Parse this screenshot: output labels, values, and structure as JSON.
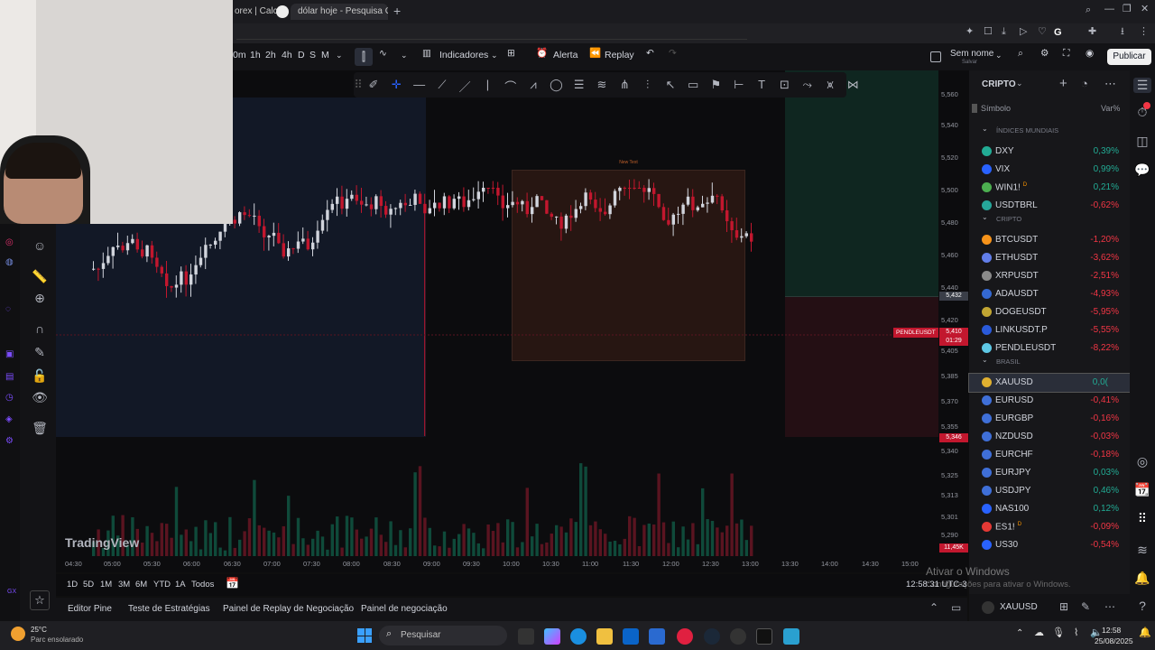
{
  "browser": {
    "tabs": [
      {
        "label": "orex | Calc"
      },
      {
        "label": "dólar hoje - Pesquisa Goo"
      }
    ],
    "new_tab": "+"
  },
  "toolbar": {
    "intervals": [
      "0m",
      "1h",
      "2h",
      "4h",
      "D",
      "S",
      "M"
    ],
    "indicators": "Indicadores",
    "alert": "Alerta",
    "replay": "Replay",
    "layout_name": "Sem nome",
    "layout_sub": "Salvar",
    "publish": "Publicar"
  },
  "chart": {
    "watermark": "TradingView",
    "box_label": "New Text",
    "symbol_tag": "PENDLEUSDT",
    "prices": [
      "5,560",
      "5,540",
      "5,520",
      "5,500",
      "5,480",
      "5,460",
      "5,440",
      "5,420",
      "5,405",
      "5,385",
      "5,370",
      "5,355",
      "5,340",
      "5,325",
      "5,313",
      "5,301",
      "5,290"
    ],
    "price_tags": {
      "current": "5,432",
      "last": "5,410",
      "countdown": "01:29",
      "low": "5,346",
      "volume": "11,45K"
    },
    "times": [
      "04:30",
      "05:00",
      "05:30",
      "06:00",
      "06:30",
      "07:00",
      "07:30",
      "08:00",
      "08:30",
      "09:00",
      "09:30",
      "10:00",
      "10:30",
      "11:00",
      "11:30",
      "12:00",
      "12:30",
      "13:00",
      "13:30",
      "14:00",
      "14:30",
      "15:00"
    ]
  },
  "range_bar": {
    "ranges": [
      "1D",
      "5D",
      "1M",
      "3M",
      "6M",
      "YTD",
      "1A",
      "Todos"
    ],
    "clock": "12:58:31 UTC-3"
  },
  "bottom_tabs": [
    "Editor Pine",
    "Teste de Estratégias",
    "Painel de Replay de Negociação",
    "Painel de negociação"
  ],
  "watchlist": {
    "title": "CRIPTO",
    "col_symbol": "Símbolo",
    "col_change": "Var%",
    "sections": [
      {
        "name": "ÍNDICES MUNDIAIS",
        "items": [
          {
            "symbol": "DXY",
            "change": "0,39%",
            "dir": "pos",
            "color": "#22ab94"
          },
          {
            "symbol": "VIX",
            "change": "0,99%",
            "dir": "pos",
            "color": "#2962ff"
          },
          {
            "symbol": "WIN1!",
            "mark": "D",
            "change": "0,21%",
            "dir": "pos",
            "color": "#4caf50"
          },
          {
            "symbol": "USDTBRL",
            "change": "-0,62%",
            "dir": "neg",
            "color": "#26a69a"
          }
        ]
      },
      {
        "name": "CRIPTO",
        "items": [
          {
            "symbol": "BTCUSDT",
            "change": "-1,20%",
            "dir": "neg",
            "color": "#f7931a"
          },
          {
            "symbol": "ETHUSDT",
            "change": "-3,62%",
            "dir": "neg",
            "color": "#627eea"
          },
          {
            "symbol": "XRPUSDT",
            "change": "-2,51%",
            "dir": "neg",
            "color": "#8a8a8a"
          },
          {
            "symbol": "ADAUSDT",
            "change": "-4,93%",
            "dir": "neg",
            "color": "#3468d1"
          },
          {
            "symbol": "DOGEUSDT",
            "change": "-5,95%",
            "dir": "neg",
            "color": "#c2a633"
          },
          {
            "symbol": "LINKUSDT.P",
            "change": "-5,55%",
            "dir": "neg",
            "color": "#2a5ada"
          },
          {
            "symbol": "PENDLEUSDT",
            "change": "-8,22%",
            "dir": "neg",
            "color": "#5ec8e5"
          }
        ]
      },
      {
        "name": "BRASIL",
        "items": [
          {
            "symbol": "XAUUSD",
            "change": "0,0(",
            "dir": "pos",
            "color": "#e0b030"
          },
          {
            "symbol": "EURUSD",
            "change": "-0,41%",
            "dir": "neg",
            "color": "#3f6fd8"
          },
          {
            "symbol": "EURGBP",
            "change": "-0,16%",
            "dir": "neg",
            "color": "#3f6fd8"
          },
          {
            "symbol": "NZDUSD",
            "change": "-0,03%",
            "dir": "neg",
            "color": "#3f6fd8"
          },
          {
            "symbol": "EURCHF",
            "change": "-0,18%",
            "dir": "neg",
            "color": "#3f6fd8"
          },
          {
            "symbol": "EURJPY",
            "change": "0,03%",
            "dir": "pos",
            "color": "#3f6fd8"
          },
          {
            "symbol": "USDJPY",
            "change": "0,46%",
            "dir": "pos",
            "color": "#3f6fd8"
          },
          {
            "symbol": "NAS100",
            "change": "0,12%",
            "dir": "pos",
            "color": "#2962ff"
          },
          {
            "symbol": "ES1!",
            "mark": "D",
            "change": "-0,09%",
            "dir": "neg",
            "color": "#e53935"
          },
          {
            "symbol": "US30",
            "change": "-0,54%",
            "dir": "neg",
            "color": "#2962ff"
          }
        ]
      }
    ],
    "footer_symbol": "XAUUSD"
  },
  "overlay": {
    "windows_title": "Ativar o Windows",
    "windows_sub": "Configurações para ativar o Windows."
  },
  "taskbar": {
    "temp": "25°C",
    "weather": "Parc ensolarado",
    "search": "Pesquisar",
    "time": "12:58",
    "date": "25/08/2025"
  },
  "colors": {
    "up": "#d1d4dc",
    "down": "#c2172e",
    "accent": "#2962ff"
  }
}
